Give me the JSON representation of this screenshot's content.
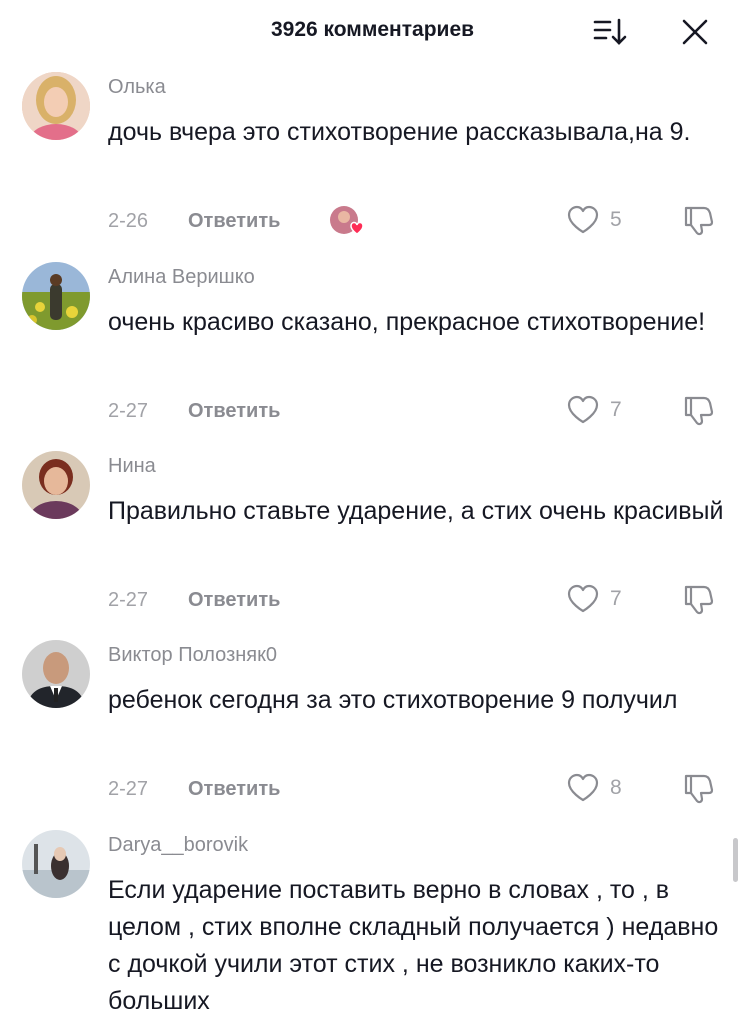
{
  "header": {
    "title": "3926 комментариев",
    "sort_icon": "sort-icon",
    "close_icon": "close-icon"
  },
  "comments": [
    {
      "username": "Олька",
      "text": "дочь вчера это стихотворение рассказывала,на 9.",
      "date": "2-26",
      "reply_label": "Ответить",
      "likes": "5",
      "liked_by_creator": true
    },
    {
      "username": "Алина Веришко",
      "text": "очень красиво сказано, прекрасное стихотворение!",
      "date": "2-27",
      "reply_label": "Ответить",
      "likes": "7"
    },
    {
      "username": "Нина",
      "text": "Правильно ставьте ударение, а стих очень красивый",
      "date": "2-27",
      "reply_label": "Ответить",
      "likes": "7"
    },
    {
      "username": "Виктор Полозняк0",
      "text": "ребенок сегодня за это стихотворение 9 получил",
      "date": "2-27",
      "reply_label": "Ответить",
      "likes": "8"
    },
    {
      "username": "Darya__borovik",
      "text": "Если ударение поставить верно в словах , то , в целом , стих вполне складный получается ) недавно с дочкой учили этот стих , не возникло каких-то больших"
    }
  ],
  "colors": {
    "text": "#161823",
    "secondary": "#8a8b91",
    "muted": "#a1a2a7",
    "creator_heart": "#fe2c55"
  }
}
